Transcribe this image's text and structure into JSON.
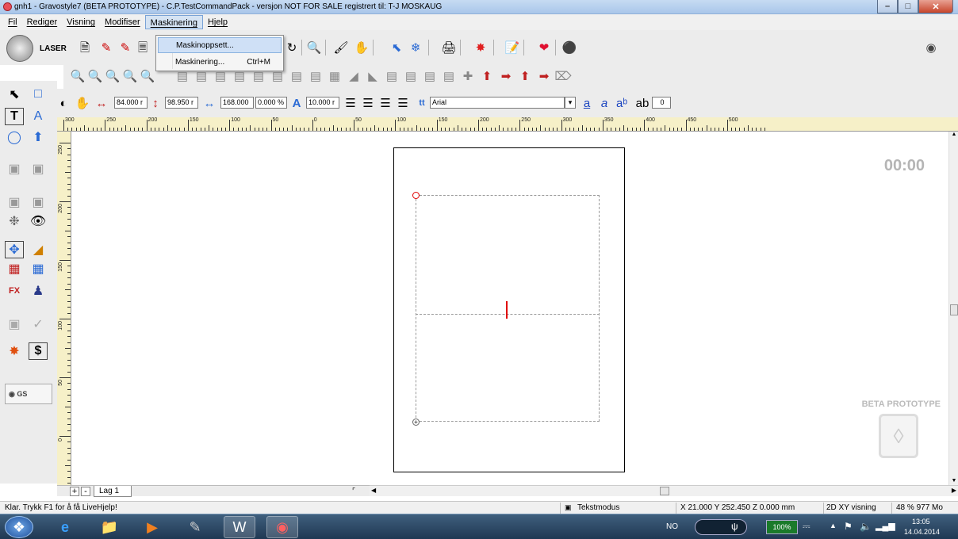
{
  "window": {
    "title": "gnh1 - Gravostyle7 (BETA PROTOTYPE) - C.P.TestCommandPack - versjon NOT FOR SALE registrert til: T-J MOSKAUG"
  },
  "menu": {
    "items": [
      "Fil",
      "Rediger",
      "Visning",
      "Modifiser",
      "Maskinering",
      "Hjelp"
    ],
    "active": "Maskinering"
  },
  "dropdown": {
    "items": [
      {
        "label": "Maskinoppsett...",
        "shortcut": ""
      },
      {
        "label": "Maskinering...",
        "shortcut": "Ctrl+M"
      }
    ]
  },
  "toolbar": {
    "laser_label": "LASER",
    "x_value": "84.000 r",
    "y_value": "98.950 r",
    "width_value": "168.000",
    "percent_value": "0.000 %",
    "height_value": "10.000 r",
    "font_name": "Arial",
    "spacing_value": "0"
  },
  "ruler": {
    "h_labels": [
      "300",
      "250",
      "200",
      "150",
      "100",
      "50",
      "0",
      "50",
      "100",
      "150",
      "200",
      "250",
      "300",
      "350",
      "400",
      "450",
      "500"
    ],
    "v_labels": [
      "250",
      "200",
      "150",
      "100",
      "50",
      "0"
    ]
  },
  "canvas": {
    "timer": "00:00",
    "watermark": "BETA PROTOTYPE"
  },
  "layers": {
    "add": "+",
    "remove": "-",
    "tab": "Lag 1"
  },
  "status": {
    "help": "Klar. Trykk F1 for å få LiveHjelp!",
    "mode": "Tekstmodus",
    "coords": "X 21.000  Y 252.450  Z 0.000 mm",
    "view": "2D XY visning",
    "zoom": "48 % 977 Mo"
  },
  "taskbar": {
    "lang": "NO",
    "battery": "100%",
    "time": "13:05",
    "date": "14.04.2014"
  },
  "colors": {
    "accent_red": "#e00000",
    "ruler_bg": "#f6f0c8",
    "taskbar": "#1f3853"
  }
}
